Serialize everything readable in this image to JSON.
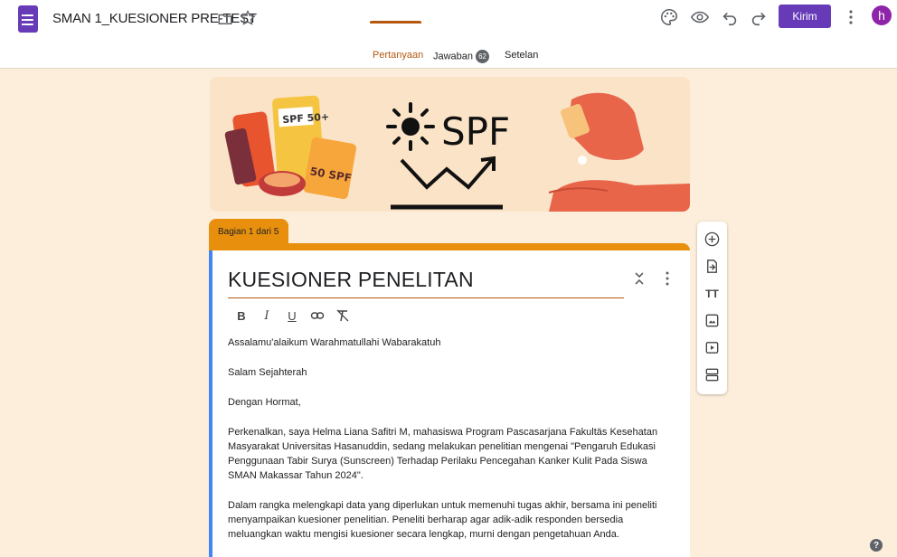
{
  "header": {
    "doc_title": "SMAN 1_KUESIONER PRE-TEST",
    "send_label": "Kirim",
    "avatar_letter": "h"
  },
  "tabs": [
    {
      "label": "Pertanyaan",
      "active": true
    },
    {
      "label": "Jawaban",
      "count": "62"
    },
    {
      "label": "Setelan"
    }
  ],
  "banner": {
    "text": "SPF",
    "bottle_labels": [
      "SPF 50+",
      "50 SPF"
    ]
  },
  "section": {
    "label": "Bagian 1 dari 5",
    "title": "KUESIONER PENELITAN",
    "format_labels": {
      "bold": "B",
      "italic": "I",
      "underline": "U"
    },
    "description": [
      "Assalamu'alaikum Warahmatullahi Wabarakatuh",
      "Salam Sejahterah",
      "Dengan Hormat,",
      "Perkenalkan, saya Helma Liana Safitri M, mahasiswa Program Pascasarjana Fakultäs Kesehatan Masyarakat Universitas Hasanuddin, sedang melakukan penelitian mengenai \"Pengaruh Edukasi Penggunaan Tabir Surya (Sunscreen) Terhadap Perilaku Pencegahan Kanker Kulit Pada Siswa SMAN Makassar Tahun 2024\".",
      "Dalam rangka melengkapi data yang diperlukan untuk memenuhi tugas akhir, bersama ini peneliti menyampaikan kuesioner penelitian. Peneliti berharap agar adik-adik responden bersedia meluangkan waktu mengisi kuesioner secara lengkap, murni dengan pengetahuan Anda."
    ]
  },
  "side_toolbar": {
    "text_tool_label": "TT"
  },
  "help_label": "?",
  "colors": {
    "brand": "#673ab7",
    "accent": "#b5580e",
    "section": "#e8900d",
    "background": "#fdeedc",
    "focus": "#4285f4"
  }
}
